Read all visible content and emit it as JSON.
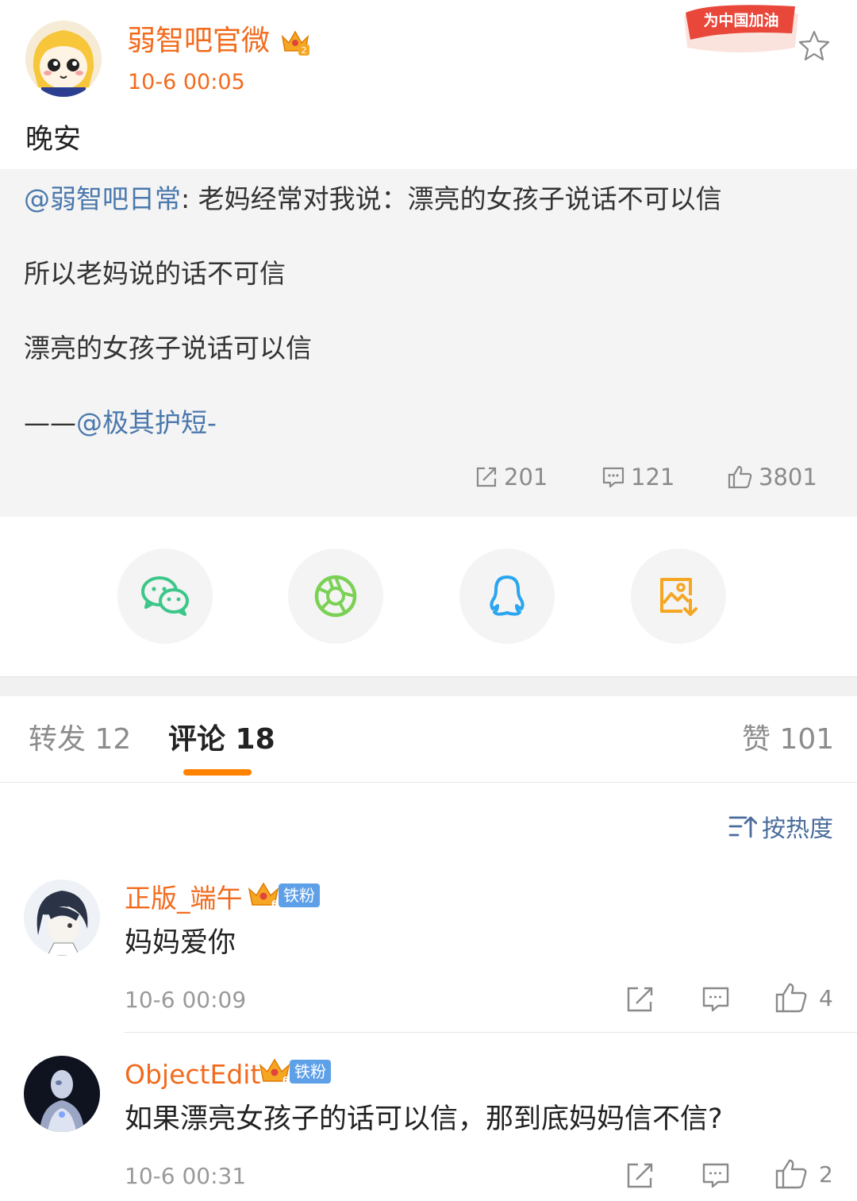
{
  "post": {
    "author": "弱智吧官微",
    "time": "10-6 00:05",
    "text": "晚安",
    "promo_badge": "为中国加油",
    "crown_level": "2",
    "icons": [
      "crown-badge-icon",
      "star-icon"
    ]
  },
  "repost": {
    "mention": "@弱智吧日常",
    "line1_rest": ": 老妈经常对我说：漂亮的女孩子说话不可以信",
    "line2": "所以老妈说的话不可信",
    "line3": "漂亮的女孩子说话可以信",
    "credit_prefix": "——",
    "credit_mention": "@极其护短-",
    "stats": {
      "reposts": "201",
      "comments": "121",
      "likes": "3801"
    }
  },
  "share": {
    "icons": [
      "wechat-icon",
      "moments-icon",
      "qq-icon",
      "save-image-icon"
    ],
    "colors": {
      "wechat": "#3cc78a",
      "moments": "#7ad154",
      "qq": "#2aa5f0",
      "save": "#f5a623"
    }
  },
  "tabs": {
    "repost": "转发 12",
    "comment": "评论 18",
    "like": "赞 101"
  },
  "sort": {
    "label": "按热度"
  },
  "comments": [
    {
      "user": "正版_端午",
      "level": "6",
      "fan_tag": "铁粉",
      "text": "妈妈爱你",
      "time": "10-6 00:09",
      "likes": "4"
    },
    {
      "user": "ObjectEdit",
      "level": "6",
      "fan_tag": "铁粉",
      "text": "如果漂亮女孩子的话可以信，那到底妈妈信不信?",
      "time": "10-6 00:31",
      "likes": "2"
    }
  ],
  "colors": {
    "accent": "#f26b1d",
    "link": "#4a78ad",
    "tab_underline": "#ff8200"
  }
}
